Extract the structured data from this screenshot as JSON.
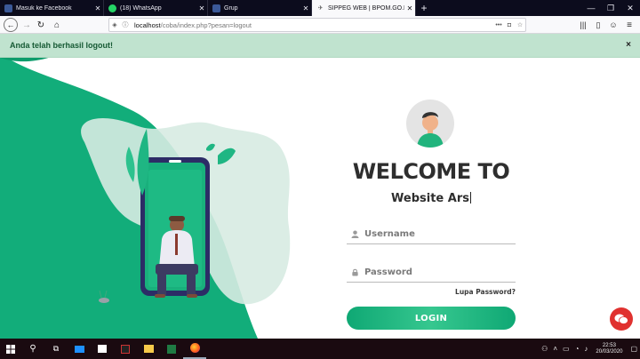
{
  "browser": {
    "tabs": [
      {
        "title": "Masuk ke Facebook",
        "icon": "facebook-icon",
        "color": "#3b5998"
      },
      {
        "title": "(18) WhatsApp",
        "icon": "whatsapp-icon",
        "color": "#25d366"
      },
      {
        "title": "Grup",
        "icon": "facebook-icon",
        "color": "#3b5998"
      },
      {
        "title": "SIPPEG WEB | BPOM.GO.ID",
        "icon": "page-icon",
        "color": "#888888"
      }
    ],
    "url_host": "localhost",
    "url_path": "/coba/index.php?pesan=logout"
  },
  "alert": {
    "message": "Anda telah berhasil logout!",
    "close": "×"
  },
  "login": {
    "welcome": "WELCOME TO",
    "subtitle": "Website Ars",
    "username_placeholder": "Username",
    "password_placeholder": "Password",
    "forgot": "Lupa Password?",
    "button": "LOGIN"
  },
  "taskbar": {
    "time": "22:53",
    "date": "20/03/2020"
  },
  "colors": {
    "accent": "#0fa874",
    "alert_bg": "#c0e3cf",
    "alert_text": "#165a34",
    "chat": "#e0312f"
  }
}
